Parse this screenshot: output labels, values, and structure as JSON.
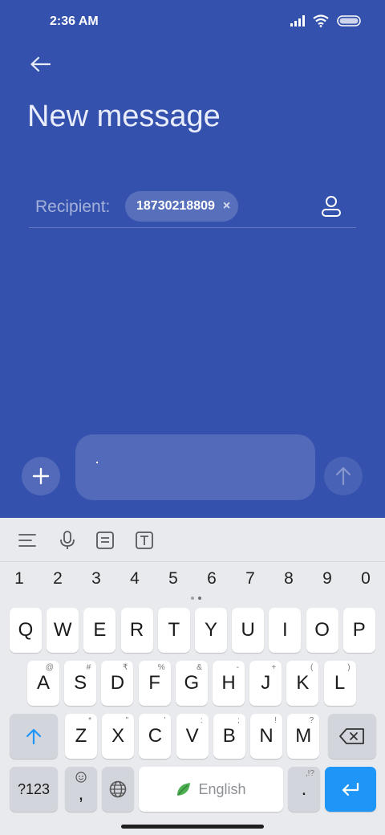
{
  "status_bar": {
    "time": "2:36 AM"
  },
  "header": {
    "title": "New message"
  },
  "recipient": {
    "label": "Recipient:",
    "chip": "18730218809",
    "chip_remove": "×"
  },
  "keyboard": {
    "numbers": [
      "1",
      "2",
      "3",
      "4",
      "5",
      "6",
      "7",
      "8",
      "9",
      "0"
    ],
    "row1": [
      {
        "key": "Q",
        "hint": ""
      },
      {
        "key": "W",
        "hint": ""
      },
      {
        "key": "E",
        "hint": ""
      },
      {
        "key": "R",
        "hint": ""
      },
      {
        "key": "T",
        "hint": ""
      },
      {
        "key": "Y",
        "hint": ""
      },
      {
        "key": "U",
        "hint": ""
      },
      {
        "key": "I",
        "hint": ""
      },
      {
        "key": "O",
        "hint": ""
      },
      {
        "key": "P",
        "hint": ""
      }
    ],
    "row2": [
      {
        "key": "A",
        "hint": "@"
      },
      {
        "key": "S",
        "hint": "#"
      },
      {
        "key": "D",
        "hint": "₹"
      },
      {
        "key": "F",
        "hint": "%"
      },
      {
        "key": "G",
        "hint": "&"
      },
      {
        "key": "H",
        "hint": "-"
      },
      {
        "key": "J",
        "hint": "+"
      },
      {
        "key": "K",
        "hint": "("
      },
      {
        "key": "L",
        "hint": ")"
      }
    ],
    "row3": [
      {
        "key": "Z",
        "hint": "*"
      },
      {
        "key": "X",
        "hint": "\""
      },
      {
        "key": "C",
        "hint": "'"
      },
      {
        "key": "V",
        "hint": ":"
      },
      {
        "key": "B",
        "hint": ";"
      },
      {
        "key": "N",
        "hint": "!"
      },
      {
        "key": "M",
        "hint": "?"
      }
    ],
    "sym_label": "?123",
    "comma_label": ",",
    "space_label": "English",
    "period_label": ".",
    "period_hint": ",!?",
    "accent_color": "#1e96f7"
  }
}
